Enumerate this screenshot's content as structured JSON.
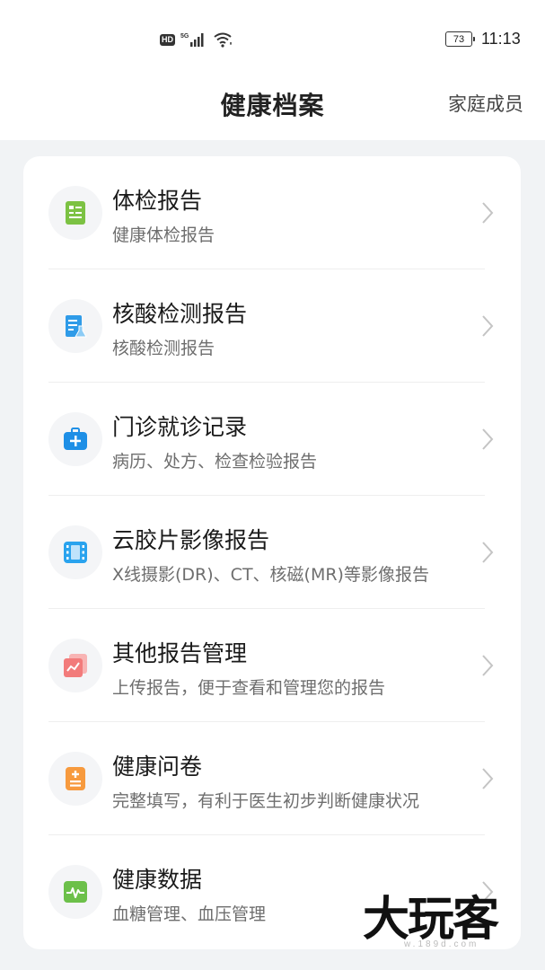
{
  "status_bar": {
    "hd_label": "HD",
    "network_label": "5G",
    "battery": "73",
    "time": "11:13"
  },
  "header": {
    "title": "健康档案",
    "family_link": "家庭成员"
  },
  "items": [
    {
      "title": "体检报告",
      "subtitle": "健康体检报告",
      "icon": "physical-exam-report-icon",
      "color": "#7cc243"
    },
    {
      "title": "核酸检测报告",
      "subtitle": "核酸检测报告",
      "icon": "nucleic-acid-test-icon",
      "color": "#2f9be8"
    },
    {
      "title": "门诊就诊记录",
      "subtitle": "病历、处方、检查检验报告",
      "icon": "medical-kit-icon",
      "color": "#1e8fe6"
    },
    {
      "title": "云胶片影像报告",
      "subtitle": "X线摄影(DR)、CT、核磁(MR)等影像报告",
      "icon": "film-icon",
      "color": "#2aa3ee"
    },
    {
      "title": "其他报告管理",
      "subtitle": "上传报告，便于查看和管理您的报告",
      "icon": "report-cards-icon",
      "color": "#f27b7b"
    },
    {
      "title": "健康问卷",
      "subtitle": "完整填写，有利于医生初步判断健康状况",
      "icon": "questionnaire-icon",
      "color": "#f79a3e"
    },
    {
      "title": "健康数据",
      "subtitle": "血糖管理、血压管理",
      "icon": "health-data-icon",
      "color": "#6cc04a"
    }
  ],
  "watermark": {
    "text": "大玩客",
    "url": "w.189d.com"
  }
}
